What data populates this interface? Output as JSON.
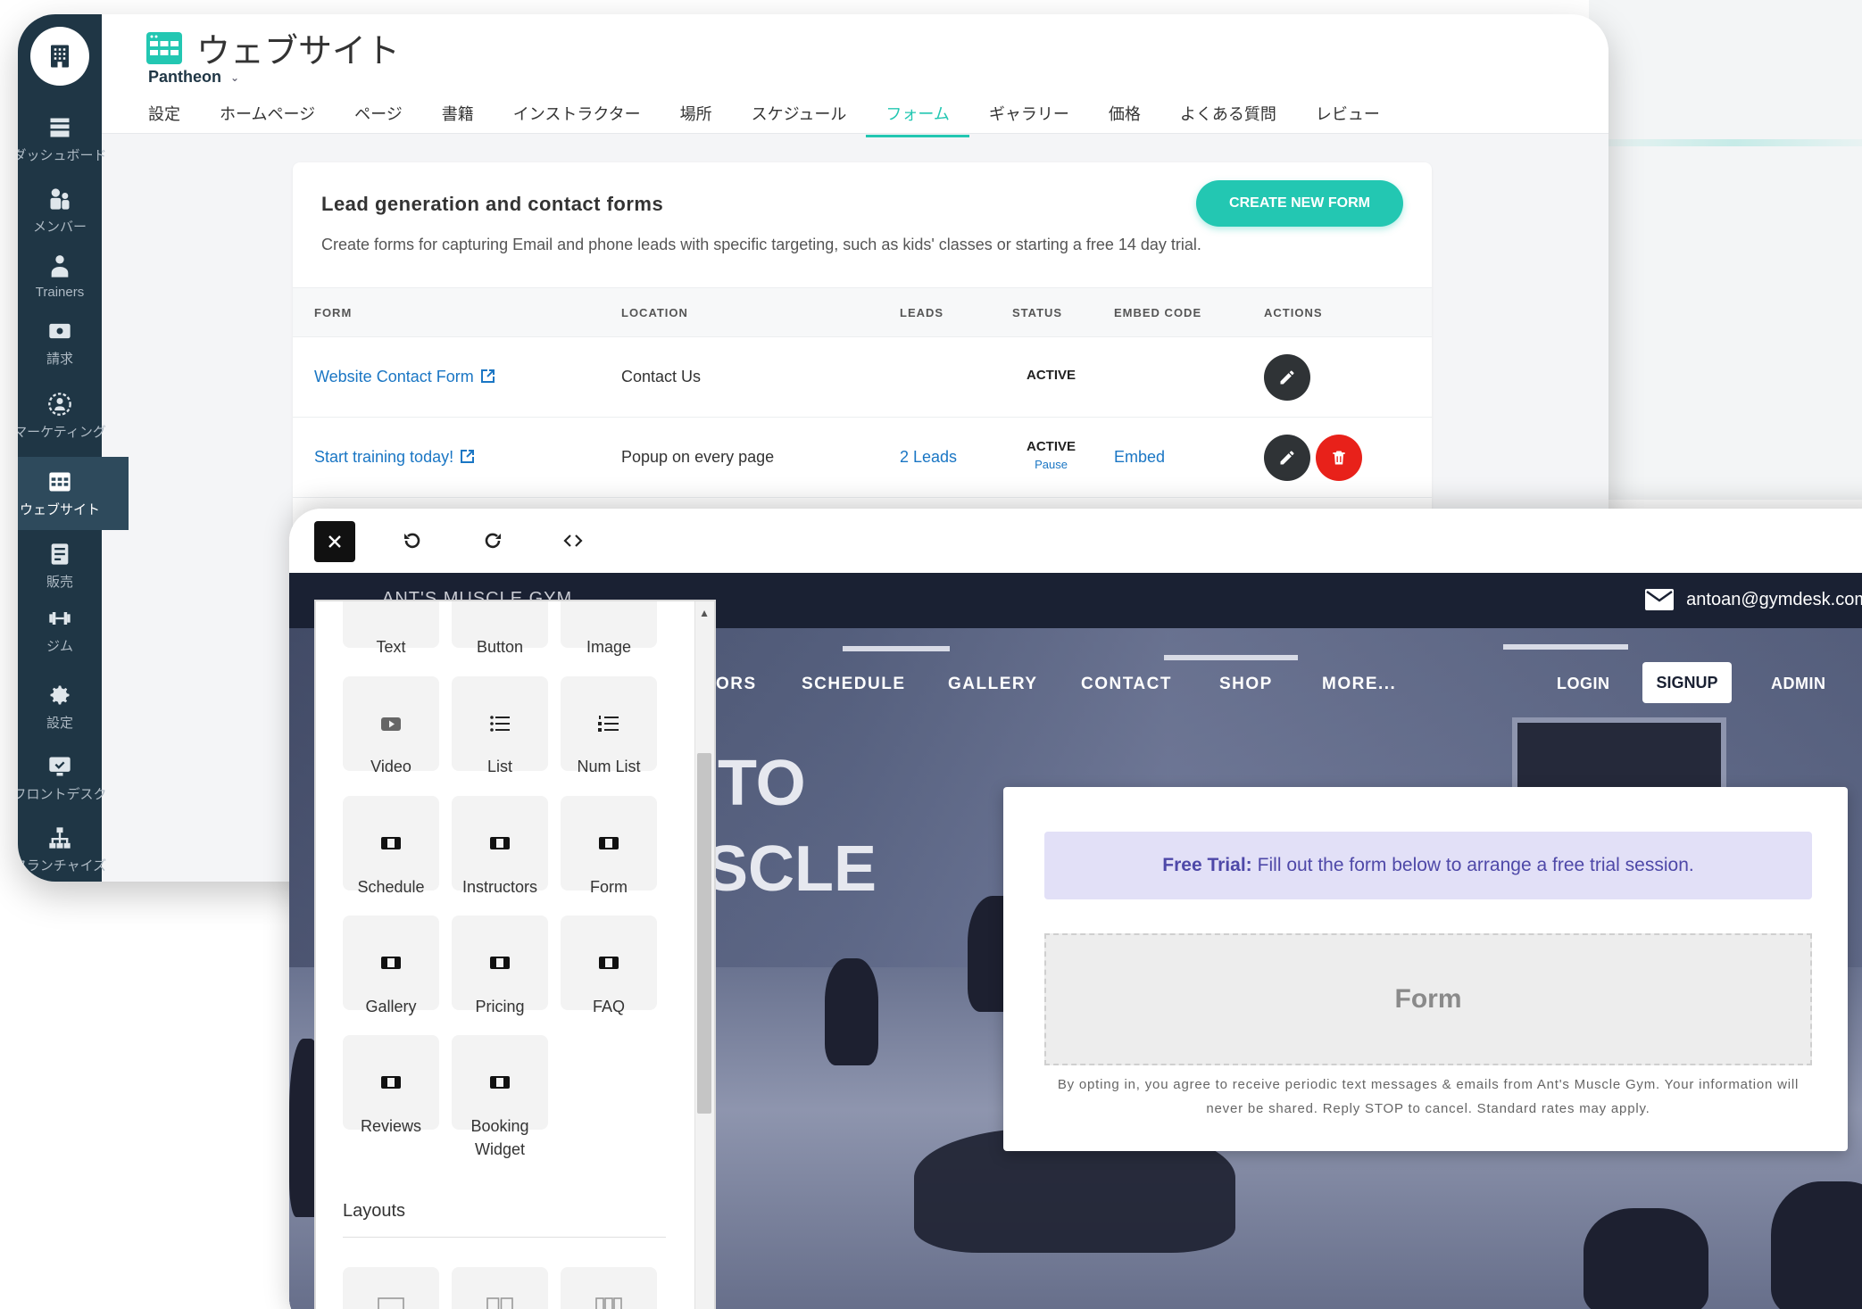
{
  "sidebar": {
    "items": [
      {
        "label": "ダッシュボード",
        "icon": "dashboard-icon"
      },
      {
        "label": "メンバー",
        "icon": "members-icon"
      },
      {
        "label": "Trainers",
        "icon": "trainers-icon"
      },
      {
        "label": "請求",
        "icon": "billing-icon"
      },
      {
        "label": "マーケティング",
        "icon": "marketing-icon"
      },
      {
        "label": "ウェブサイト",
        "icon": "website-icon"
      },
      {
        "label": "販売",
        "icon": "sales-icon"
      },
      {
        "label": "ジム",
        "icon": "gym-icon"
      },
      {
        "label": "設定",
        "icon": "gear-icon"
      },
      {
        "label": "フロントデスク",
        "icon": "front-desk-icon"
      },
      {
        "label": "フランチャイズ",
        "icon": "franchise-icon"
      }
    ],
    "active_index": 5
  },
  "header": {
    "title": "ウェブサイト",
    "site_name": "Pantheon",
    "tabs": [
      "設定",
      "ホームページ",
      "ページ",
      "書籍",
      "インストラクター",
      "場所",
      "スケジュール",
      "フォーム",
      "ギャラリー",
      "価格",
      "よくある質問",
      "レビュー"
    ],
    "active_tab": "フォーム"
  },
  "forms": {
    "title": "Lead generation and contact forms",
    "description": "Create forms for capturing Email and phone leads with specific targeting, such as kids' classes or starting a free 14 day trial.",
    "create_label": "CREATE NEW FORM",
    "columns": [
      "FORM",
      "LOCATION",
      "LEADS",
      "STATUS",
      "EMBED CODE",
      "ACTIONS"
    ],
    "rows": [
      {
        "form": "Website Contact Form",
        "location": "Contact Us",
        "leads": "",
        "status": "ACTIVE",
        "pause": "",
        "embed": ""
      },
      {
        "form": "Start training today!",
        "location": "Popup on every page",
        "leads": "2 Leads",
        "status": "ACTIVE",
        "pause": "Pause",
        "embed": "Embed"
      }
    ]
  },
  "editor": {
    "toolbar": [
      "close-icon",
      "undo-icon",
      "redo-icon",
      "code-icon"
    ],
    "elements": [
      {
        "label": "Text",
        "icon": "text-icon"
      },
      {
        "label": "Button",
        "icon": "button-icon"
      },
      {
        "label": "Image",
        "icon": "image-icon"
      },
      {
        "label": "Video",
        "icon": "video-icon"
      },
      {
        "label": "List",
        "icon": "list-icon"
      },
      {
        "label": "Num List",
        "icon": "numbered-list-icon"
      },
      {
        "label": "Schedule",
        "icon": "widget-icon"
      },
      {
        "label": "Instructors",
        "icon": "widget-icon"
      },
      {
        "label": "Form",
        "icon": "widget-icon"
      },
      {
        "label": "Gallery",
        "icon": "widget-icon"
      },
      {
        "label": "Pricing",
        "icon": "widget-icon"
      },
      {
        "label": "FAQ",
        "icon": "widget-icon"
      },
      {
        "label": "Reviews",
        "icon": "widget-icon"
      },
      {
        "label": "Booking Widget",
        "icon": "widget-icon"
      }
    ],
    "layouts_label": "Layouts"
  },
  "preview": {
    "brand": "ANT'S MUSCLE GYM",
    "email": "antoan@gymdesk.com",
    "nav": [
      "ORS",
      "SCHEDULE",
      "GALLERY",
      "CONTACT",
      "SHOP",
      "MORE..."
    ],
    "login": "LOGIN",
    "signup": "SIGNUP",
    "admin": "ADMIN",
    "hero_line1": "TO",
    "hero_line2": "SCLE",
    "notice_bold": "Free Trial:",
    "notice_text": "Fill out the form below to arrange a free trial session.",
    "form_placeholder": "Form",
    "disclaimer": "By opting in, you agree to receive periodic text messages & emails from Ant's Muscle Gym. Your information will never be shared. Reply STOP to cancel. Standard rates may apply."
  },
  "colors": {
    "accent": "#23c7b2",
    "sidebar": "#1f3645",
    "link": "#1a76c4",
    "danger": "#e8211a",
    "stats_bar": "#6e5fe3"
  }
}
